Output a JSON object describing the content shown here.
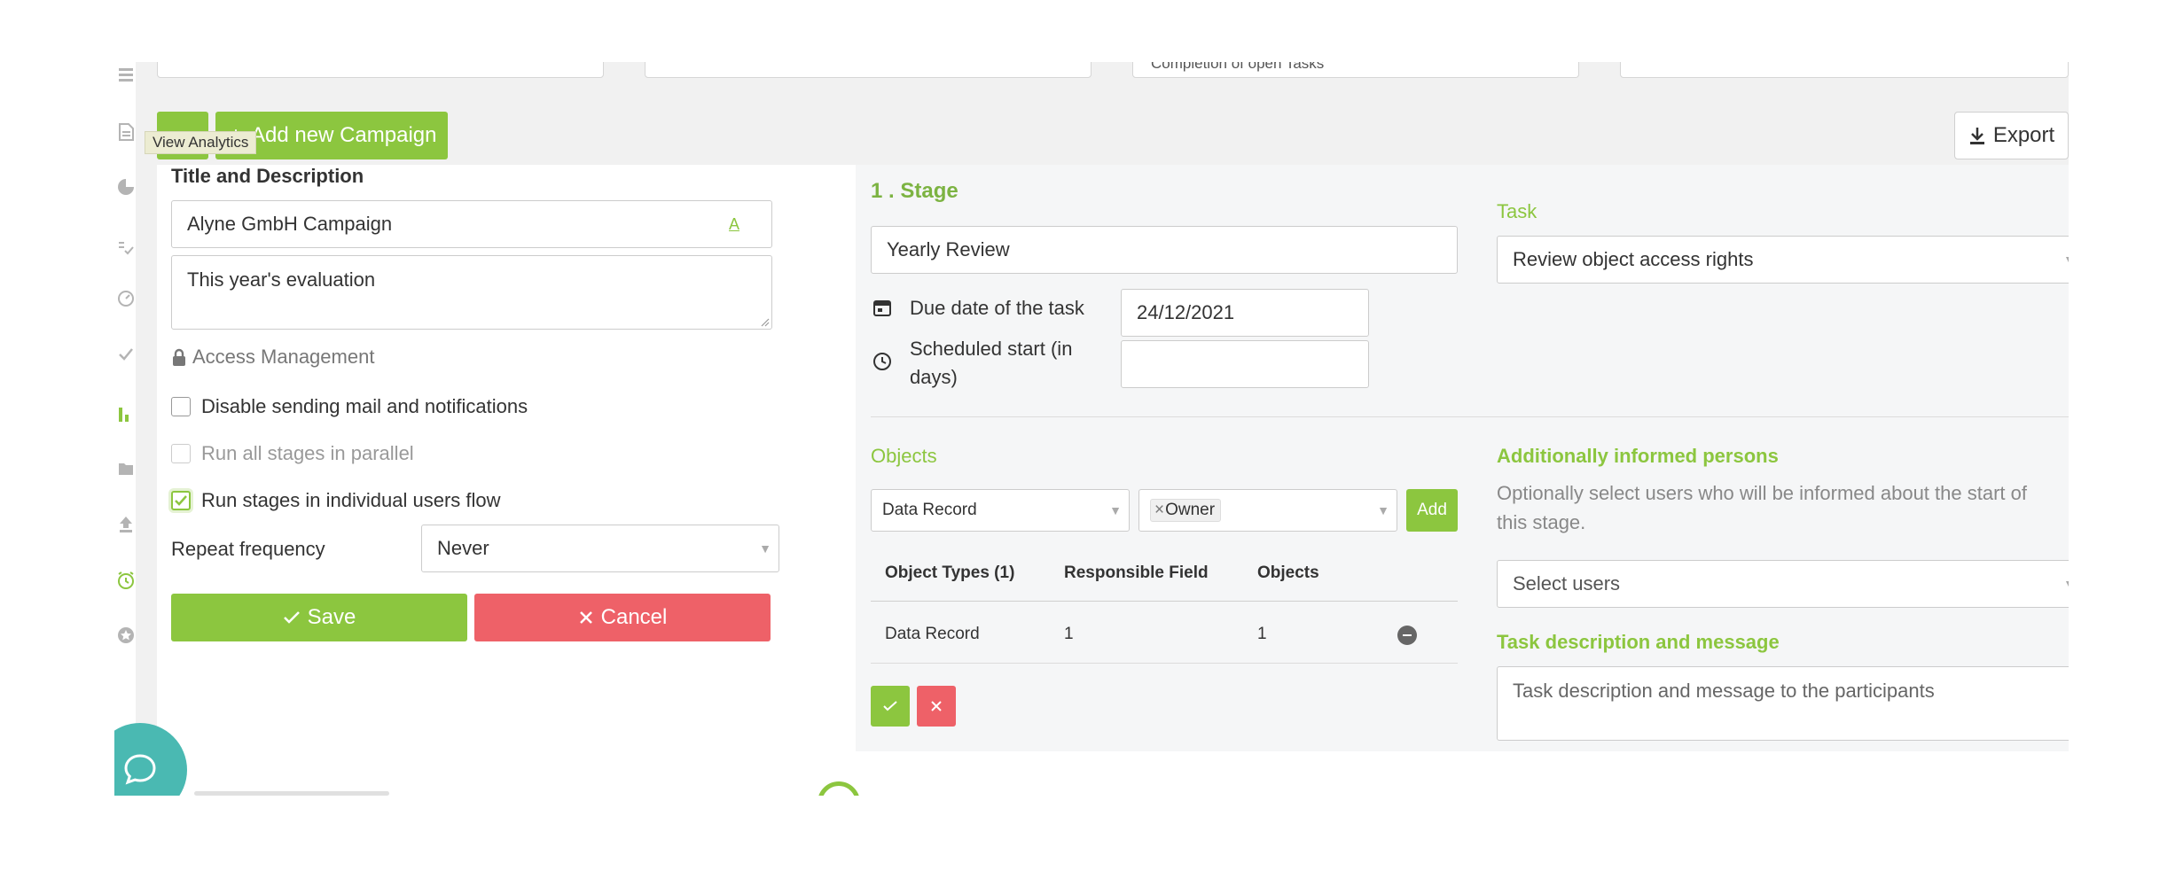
{
  "filters": {
    "box3_text": "Completion of open Tasks"
  },
  "toolbar": {
    "add_campaign_label": "Add new Campaign",
    "tooltip": "View Analytics",
    "export_label": "Export"
  },
  "form": {
    "section_title": "Title and Description",
    "title_value": "Alyne GmbH Campaign",
    "description_value": "This year's evaluation",
    "access_management": "Access Management",
    "disable_mail_label": "Disable sending mail and notifications",
    "parallel_label": "Run all stages in parallel",
    "individual_flow_label": "Run stages in individual users flow",
    "repeat_label": "Repeat frequency",
    "repeat_value": "Never",
    "save_label": "Save",
    "cancel_label": "Cancel"
  },
  "stage": {
    "title": "1 . Stage",
    "name_value": "Yearly Review",
    "due_date_label": "Due date of the task",
    "due_date_value": "24/12/2021",
    "scheduled_start_label_1": "Scheduled start (in",
    "scheduled_start_label_2": "days)",
    "scheduled_start_value": "",
    "task_label": "Task",
    "task_value": "Review object access rights",
    "objects_label": "Objects",
    "object_type_select": "Data Record",
    "owner_tag": "Owner",
    "add_label": "Add",
    "table": {
      "headers": [
        "Object Types (1)",
        "Responsible Field",
        "Objects"
      ],
      "rows": [
        {
          "type": "Data Record",
          "responsible": "1",
          "objects": "1"
        }
      ]
    },
    "informed_label": "Additionally informed persons",
    "informed_help_1": "Optionally select users who will be informed about the start of",
    "informed_help_2": "this stage.",
    "select_users_placeholder": "Select users",
    "task_desc_label": "Task description and message",
    "task_desc_placeholder": "Task description and message to the participants"
  },
  "colors": {
    "accent_green": "#8cc63f",
    "danger_red": "#ee6168",
    "chat_teal": "#4ab9b2"
  }
}
